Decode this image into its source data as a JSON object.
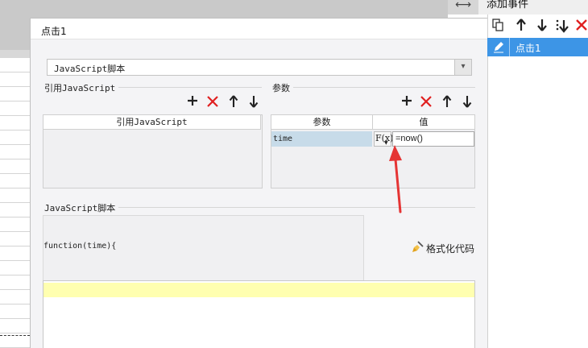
{
  "background": {
    "corner_icon": "⟷"
  },
  "right_panel": {
    "title": "添加事件",
    "toolbar_icons": [
      "copy-icon",
      "arrow-up-icon",
      "arrow-down-icon",
      "move-bottom-icon",
      "delete-icon"
    ],
    "event_item": {
      "label": "点击1",
      "icon": "edit-icon"
    }
  },
  "dialog": {
    "title": "点击1",
    "type_select": {
      "value": "JavaScript脚本",
      "arrow": "▾"
    },
    "ref_section": {
      "label": "引用JavaScript",
      "column_header": "引用JavaScript",
      "toolbar": {
        "add": "+",
        "delete": "✕",
        "up": "🡑",
        "down": "🡓"
      }
    },
    "param_section": {
      "label": "参数",
      "columns": [
        "参数",
        "值"
      ],
      "rows": [
        {
          "name": "time",
          "formula_button": "F(x)",
          "value": "=now()"
        }
      ],
      "toolbar": {
        "add": "+",
        "delete": "✕",
        "up": "🡑",
        "down": "🡓"
      }
    },
    "script_section": {
      "label": "JavaScript脚本",
      "function_signature": "function(time){",
      "format_button": "格式化代码"
    }
  },
  "colors": {
    "accent": "#3d95e6",
    "delete": "#e02020",
    "annotation_arrow": "#e53434",
    "line_highlight": "#ffffb0"
  }
}
